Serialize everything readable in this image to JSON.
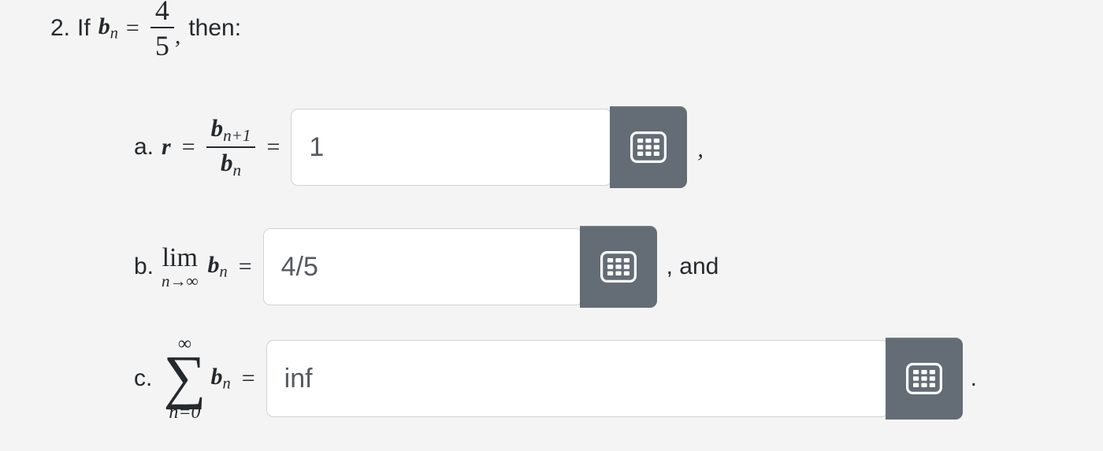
{
  "problem": {
    "number": "2.",
    "stem_if": "If",
    "sequence_symbol": "b",
    "sequence_index": "n",
    "value_numerator": "4",
    "value_denominator": "5",
    "stem_comma": ",",
    "stem_then": "then:"
  },
  "parts": [
    {
      "id": "a",
      "label": "a.",
      "expr_lhs": "r",
      "equals": "=",
      "frac_num_symbol": "b",
      "frac_num_sub": "n+1",
      "frac_den_symbol": "b",
      "frac_den_sub": "n",
      "equals2": "=",
      "answer_value": "1",
      "answer_placeholder": "",
      "keypad_icon": "keypad-grid-icon",
      "trailing_text": ","
    },
    {
      "id": "b",
      "label": "b.",
      "limit_operator": "lim",
      "limit_subscript": "n→∞",
      "expr_symbol": "b",
      "expr_sub": "n",
      "equals": "=",
      "answer_value": "4/5",
      "answer_placeholder": "",
      "keypad_icon": "keypad-grid-icon",
      "trailing_text": ", and"
    },
    {
      "id": "c",
      "label": "c.",
      "sum_upper": "∞",
      "sum_glyph": "∑",
      "sum_lower": "n=0",
      "expr_symbol": "b",
      "expr_sub": "n",
      "equals": "=",
      "answer_value": "inf",
      "answer_placeholder": "",
      "keypad_icon": "keypad-grid-icon",
      "trailing_text": "."
    }
  ],
  "colors": {
    "background": "#f4f4f4",
    "text": "#24292e",
    "input_border": "#d2d2d2",
    "input_background": "#ffffff",
    "input_text": "#555b60",
    "keypad_button": "#646c76",
    "keypad_icon": "#ffffff"
  }
}
